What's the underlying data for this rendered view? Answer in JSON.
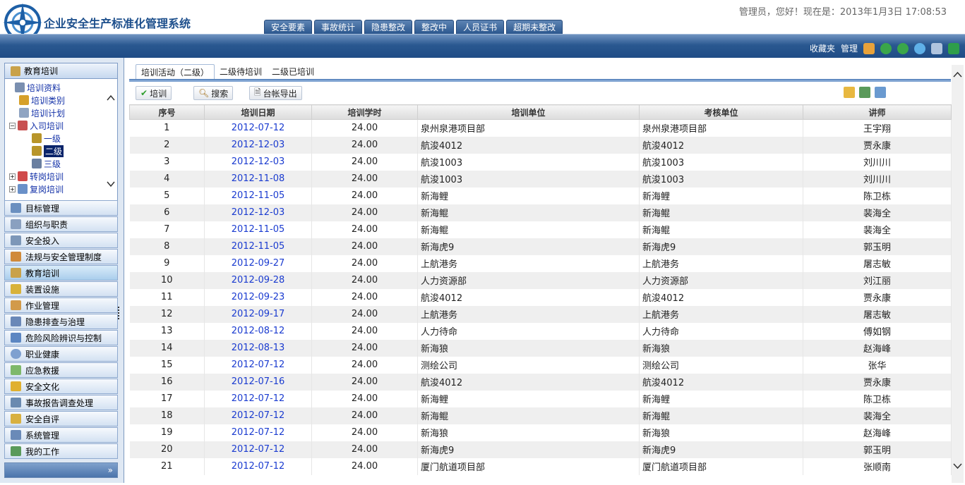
{
  "header": {
    "app_title": "企业安全生产标准化管理系统",
    "welcome": "管理员，您好！现在是：2013年1月3日 17:08:53",
    "main_tabs": [
      "安全要素",
      "事故统计",
      "隐患整改",
      "整改中",
      "人员证书",
      "超期未整改"
    ],
    "links": {
      "favorites": "收藏夹",
      "manage": "管理"
    }
  },
  "sidebar": {
    "tree_title": "教育培训",
    "tree_items": [
      {
        "label": "培训资料",
        "icon": "book-icon"
      },
      {
        "label": "培训类别",
        "icon": "category-icon"
      },
      {
        "label": "培训计划",
        "icon": "plan-icon"
      },
      {
        "label": "入司培训",
        "icon": "folder-icon"
      },
      {
        "label": "一级",
        "icon": "level-icon"
      },
      {
        "label": "二级",
        "icon": "level-icon"
      },
      {
        "label": "三级",
        "icon": "user-icon"
      },
      {
        "label": "转岗培训",
        "icon": "transfer-icon"
      },
      {
        "label": "复岗培训",
        "icon": "return-icon"
      }
    ],
    "menu": [
      {
        "label": "目标管理",
        "icon": "target-icon"
      },
      {
        "label": "组织与职责",
        "icon": "org-icon"
      },
      {
        "label": "安全投入",
        "icon": "invest-icon"
      },
      {
        "label": "法规与安全管理制度",
        "icon": "law-icon"
      },
      {
        "label": "教育培训",
        "icon": "education-icon"
      },
      {
        "label": "装置设施",
        "icon": "equipment-icon"
      },
      {
        "label": "作业管理",
        "icon": "work-icon"
      },
      {
        "label": "隐患排查与治理",
        "icon": "hazard-icon"
      },
      {
        "label": "危险风险辨识与控制",
        "icon": "risk-icon"
      },
      {
        "label": "职业健康",
        "icon": "health-icon"
      },
      {
        "label": "应急救援",
        "icon": "rescue-icon"
      },
      {
        "label": "安全文化",
        "icon": "culture-icon"
      },
      {
        "label": "事故报告调查处理",
        "icon": "report-icon"
      },
      {
        "label": "安全自评",
        "icon": "evaluate-icon"
      },
      {
        "label": "系统管理",
        "icon": "system-icon"
      },
      {
        "label": "我的工作",
        "icon": "mywork-icon"
      }
    ]
  },
  "content": {
    "sub_tabs": [
      "培训活动（二级）",
      "二级待培训",
      "二级已培训"
    ],
    "toolbar": {
      "train": "培训",
      "search": "搜索",
      "export": "台帐导出"
    },
    "columns": [
      "序号",
      "培训日期",
      "培训学时",
      "培训单位",
      "考核单位",
      "讲师"
    ],
    "rows": [
      [
        "1",
        "2012-07-12",
        "24.00",
        "泉州泉港项目部",
        "泉州泉港项目部",
        "王宇翔"
      ],
      [
        "2",
        "2012-12-03",
        "24.00",
        "航浚4012",
        "航浚4012",
        "贾永康"
      ],
      [
        "3",
        "2012-12-03",
        "24.00",
        "航浚1003",
        "航浚1003",
        "刘川川"
      ],
      [
        "4",
        "2012-11-08",
        "24.00",
        "航浚1003",
        "航浚1003",
        "刘川川"
      ],
      [
        "5",
        "2012-11-05",
        "24.00",
        "新海鲤",
        "新海鲤",
        "陈卫栋"
      ],
      [
        "6",
        "2012-12-03",
        "24.00",
        "新海鲲",
        "新海鲲",
        "裴海全"
      ],
      [
        "7",
        "2012-11-05",
        "24.00",
        "新海鲲",
        "新海鲲",
        "裴海全"
      ],
      [
        "8",
        "2012-11-05",
        "24.00",
        "新海虎9",
        "新海虎9",
        "郭玉明"
      ],
      [
        "9",
        "2012-09-27",
        "24.00",
        "上航港务",
        "上航港务",
        "屠志敏"
      ],
      [
        "10",
        "2012-09-28",
        "24.00",
        "人力资源部",
        "人力资源部",
        "刘江丽"
      ],
      [
        "11",
        "2012-09-23",
        "24.00",
        "航浚4012",
        "航浚4012",
        "贾永康"
      ],
      [
        "12",
        "2012-09-17",
        "24.00",
        "上航港务",
        "上航港务",
        "屠志敏"
      ],
      [
        "13",
        "2012-08-12",
        "24.00",
        "人力待命",
        "人力待命",
        "傅如钢"
      ],
      [
        "14",
        "2012-08-13",
        "24.00",
        "新海狼",
        "新海狼",
        "赵海峰"
      ],
      [
        "15",
        "2012-07-12",
        "24.00",
        "测绘公司",
        "测绘公司",
        "张华"
      ],
      [
        "16",
        "2012-07-16",
        "24.00",
        "航浚4012",
        "航浚4012",
        "贾永康"
      ],
      [
        "17",
        "2012-07-12",
        "24.00",
        "新海鲤",
        "新海鲤",
        "陈卫栋"
      ],
      [
        "18",
        "2012-07-12",
        "24.00",
        "新海鲲",
        "新海鲲",
        "裴海全"
      ],
      [
        "19",
        "2012-07-12",
        "24.00",
        "新海狼",
        "新海狼",
        "赵海峰"
      ],
      [
        "20",
        "2012-07-12",
        "24.00",
        "新海虎9",
        "新海虎9",
        "郭玉明"
      ],
      [
        "21",
        "2012-07-12",
        "24.00",
        "厦门航道项目部",
        "厦门航道项目部",
        "张顺南"
      ]
    ]
  },
  "colors": {
    "brand_blue": "#2a5890",
    "link_blue": "#1a3bd0",
    "selected": "#0a246a"
  }
}
